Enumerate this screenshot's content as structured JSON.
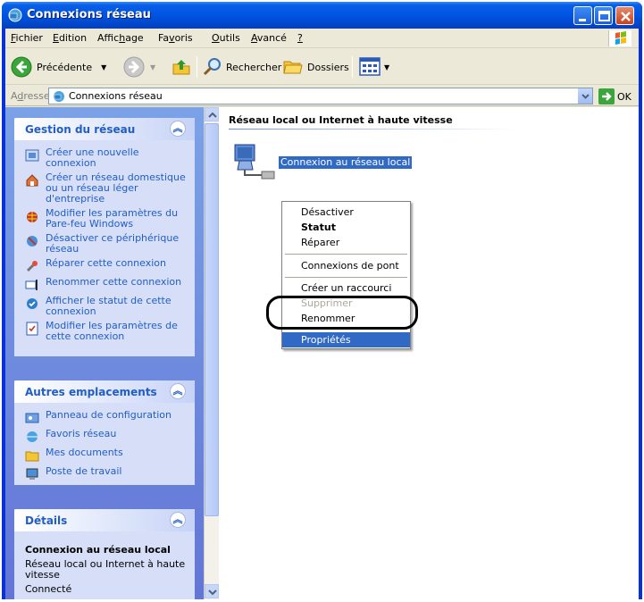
{
  "window": {
    "title": "Connexions réseau"
  },
  "menubar": {
    "items": [
      {
        "pre": "",
        "key": "F",
        "post": "ichier"
      },
      {
        "pre": "",
        "key": "E",
        "post": "dition"
      },
      {
        "pre": "Affic",
        "key": "h",
        "post": "age"
      },
      {
        "pre": "Fa",
        "key": "v",
        "post": "oris"
      },
      {
        "pre": "",
        "key": "O",
        "post": "utils"
      },
      {
        "pre": "",
        "key": "A",
        "post": "vancé"
      },
      {
        "pre": "",
        "key": "?",
        "post": ""
      }
    ]
  },
  "toolbar": {
    "back_label": "Précédente",
    "search_label": "Rechercher",
    "folders_label": "Dossiers"
  },
  "address": {
    "label_pre": "A",
    "label_key": "d",
    "label_post": "resse",
    "value": "Connexions réseau",
    "go_label": "OK"
  },
  "left": {
    "network_tasks": {
      "title": "Gestion du réseau",
      "items": [
        {
          "label": "Créer une nouvelle connexion",
          "icon": "new-connection-icon"
        },
        {
          "label": "Créer un réseau domestique ou un réseau léger d'entreprise",
          "icon": "home-network-icon"
        },
        {
          "label": "Modifier les paramètres du Pare-feu Windows",
          "icon": "firewall-icon"
        },
        {
          "label": "Désactiver ce périphérique réseau",
          "icon": "disable-device-icon"
        },
        {
          "label": "Réparer cette connexion",
          "icon": "repair-icon"
        },
        {
          "label": "Renommer cette connexion",
          "icon": "rename-icon"
        },
        {
          "label": "Afficher le statut de cette connexion",
          "icon": "status-icon"
        },
        {
          "label": "Modifier les paramètres de cette connexion",
          "icon": "settings-icon"
        }
      ]
    },
    "other_places": {
      "title": "Autres emplacements",
      "items": [
        {
          "label": "Panneau de configuration",
          "icon": "control-panel-icon"
        },
        {
          "label": "Favoris réseau",
          "icon": "network-places-icon"
        },
        {
          "label": "Mes documents",
          "icon": "my-documents-icon"
        },
        {
          "label": "Poste de travail",
          "icon": "my-computer-icon"
        }
      ]
    },
    "details": {
      "title": "Détails",
      "name": "Connexion au réseau local",
      "type": "Réseau local ou Internet à haute vitesse",
      "status": "Connecté"
    }
  },
  "main": {
    "group_title": "Réseau local ou Internet à haute vitesse",
    "connection_label": "Connexion au réseau local"
  },
  "context_menu": {
    "items": [
      {
        "label": "Désactiver",
        "style": "normal"
      },
      {
        "label": "Statut",
        "style": "bold"
      },
      {
        "label": "Réparer",
        "style": "normal"
      },
      {
        "label": "Connexions de pont",
        "style": "normal"
      },
      {
        "label": "Créer un raccourci",
        "style": "normal"
      },
      {
        "label": "Supprimer",
        "style": "disabled"
      },
      {
        "label": "Renommer",
        "style": "normal"
      },
      {
        "label": "Propriétés",
        "style": "selected"
      }
    ]
  },
  "colors": {
    "titlebar": "#0054e3",
    "selection": "#316ac5",
    "task_link": "#215dc6"
  }
}
